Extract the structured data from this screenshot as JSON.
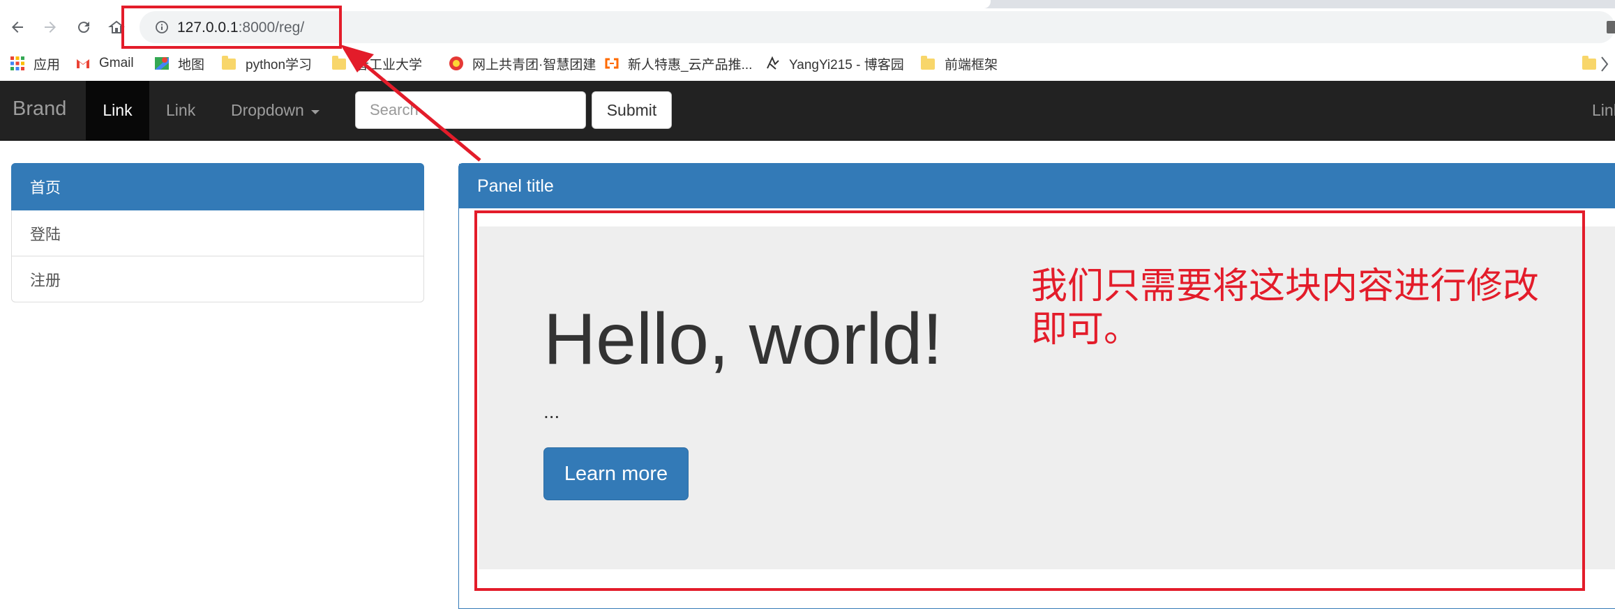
{
  "browser": {
    "url_host": "127.0.0.1",
    "url_path": ":8000/reg/"
  },
  "bookmarks": [
    {
      "label": "应用",
      "icon": "apps-grid-icon"
    },
    {
      "label": "Gmail",
      "icon": "gmail-icon"
    },
    {
      "label": "地图",
      "icon": "maps-icon"
    },
    {
      "label": "python学习",
      "icon": "folder-icon"
    },
    {
      "label": "春工业大学",
      "icon": "folder-icon"
    },
    {
      "label": "网上共青团·智慧团建",
      "icon": "league-badge-icon"
    },
    {
      "label": "新人特惠_云产品推...",
      "icon": "aliyun-icon"
    },
    {
      "label": "YangYi215 - 博客园",
      "icon": "cnblogs-icon"
    },
    {
      "label": "前端框架",
      "icon": "folder-icon"
    }
  ],
  "navbar": {
    "brand": "Brand",
    "link_active": "Link",
    "link": "Link",
    "dropdown": "Dropdown",
    "search_placeholder": "Search",
    "submit": "Submit",
    "right_link": "Link"
  },
  "sidebar": {
    "items": [
      {
        "label": "首页"
      },
      {
        "label": "登陆"
      },
      {
        "label": "注册"
      }
    ]
  },
  "panel": {
    "title": "Panel title"
  },
  "jumbotron": {
    "heading": "Hello, world!",
    "text": "...",
    "button": "Learn more"
  },
  "annotation": {
    "text": "我们只需要将这块内容进行修改即可。",
    "color": "#e31c2a"
  },
  "colors": {
    "primary": "#337ab7",
    "navbar_bg": "#222222",
    "jumbotron_bg": "#eeeeee"
  }
}
